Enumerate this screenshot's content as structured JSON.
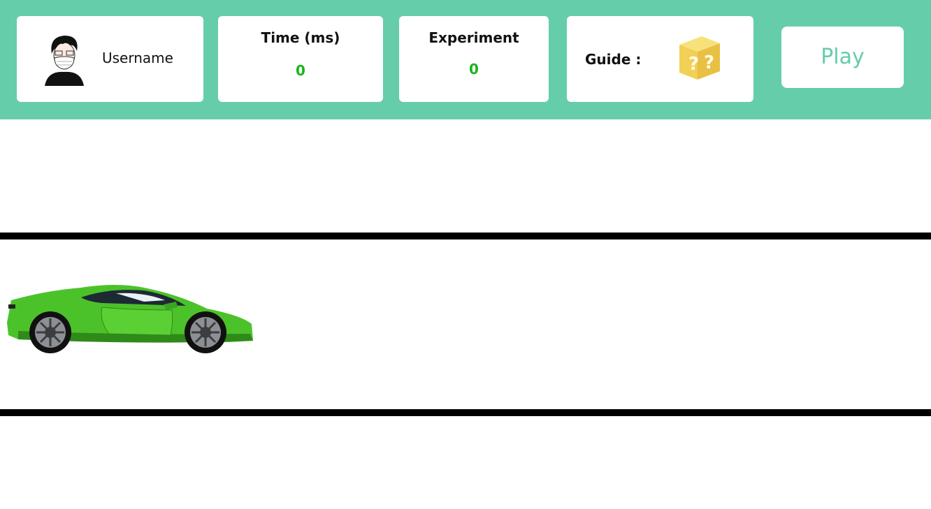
{
  "header": {
    "user": {
      "username": "Username",
      "avatar_icon": "user-avatar-icon"
    },
    "time": {
      "title": "Time (ms)",
      "value": "0"
    },
    "experiment": {
      "title": "Experiment",
      "value": "0"
    },
    "guide": {
      "label": "Guide :",
      "icon": "mystery-box-icon"
    },
    "play_label": "Play"
  },
  "track": {
    "car_icon": "green-sports-car"
  },
  "colors": {
    "topbar": "#66cdaa",
    "card": "#ffffff",
    "value_green": "#1db31d",
    "play_text": "#66cdaa",
    "track_line": "#000000",
    "car_body": "#4cc22a"
  }
}
